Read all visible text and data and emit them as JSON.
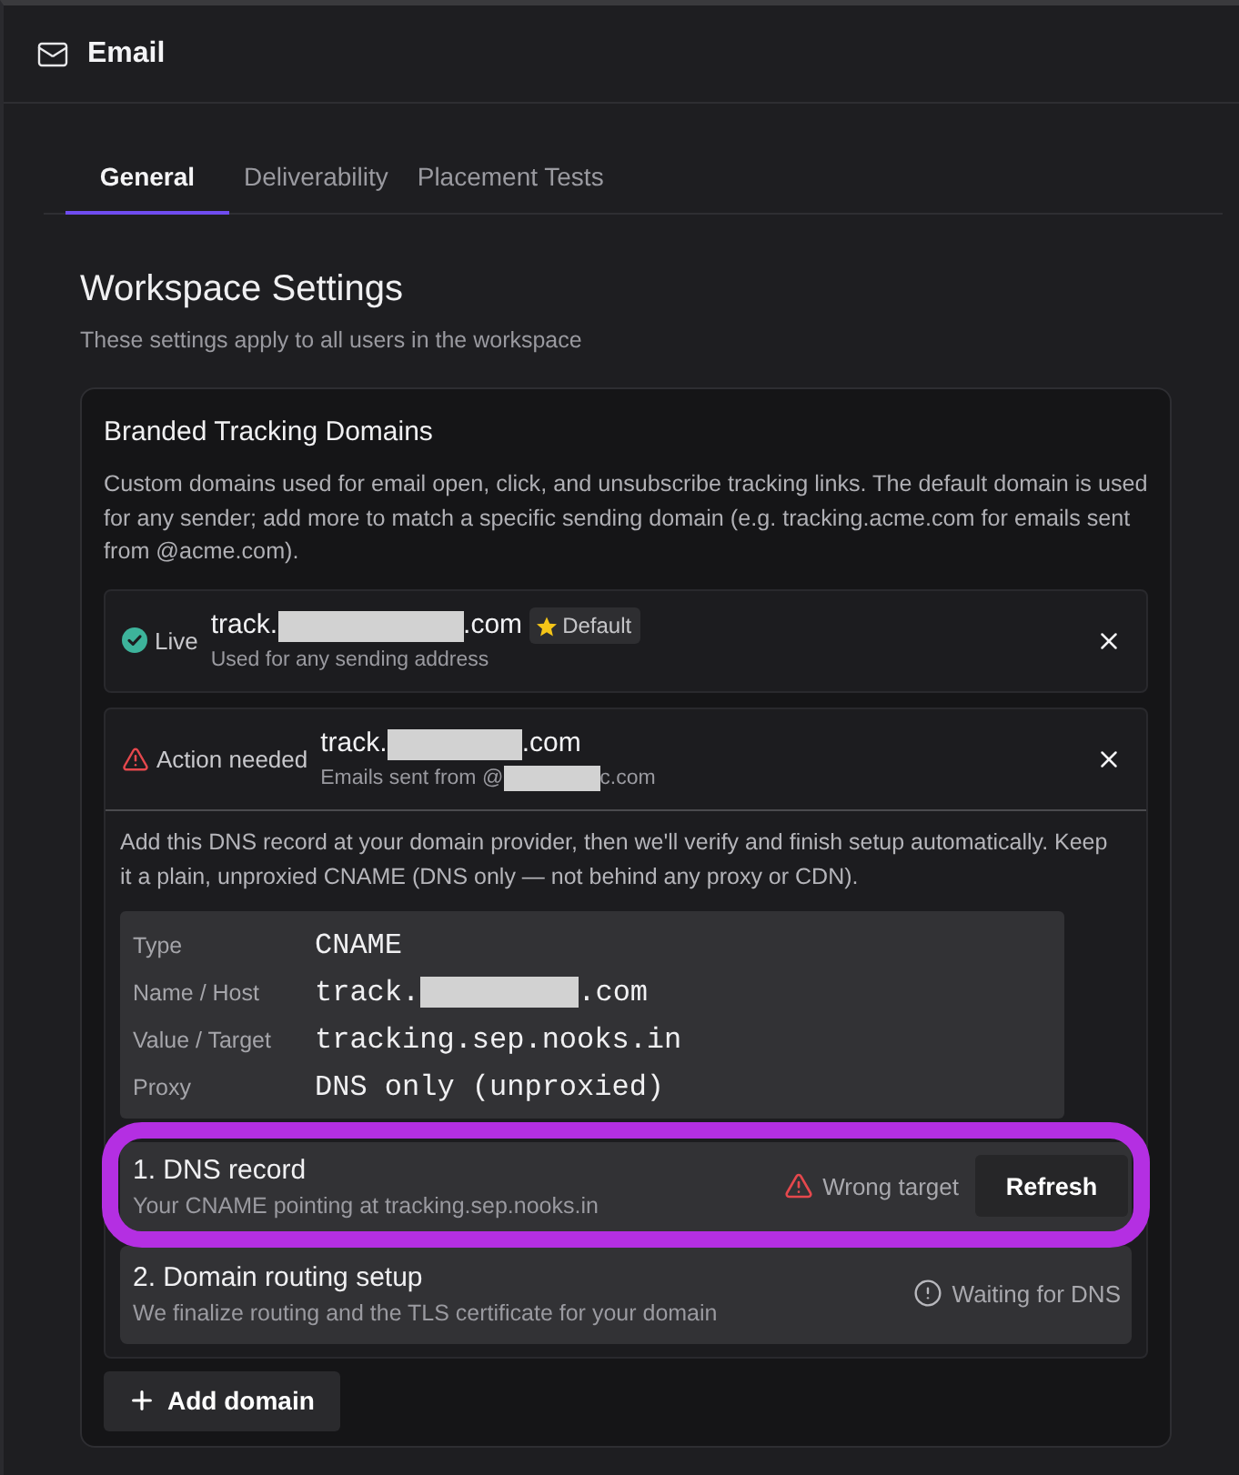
{
  "header": {
    "title": "Email"
  },
  "tabs": [
    {
      "label": "General",
      "selected": true
    },
    {
      "label": "Deliverability",
      "selected": false
    },
    {
      "label": "Placement Tests",
      "selected": false
    }
  ],
  "section": {
    "title": "Workspace Settings",
    "subtitle": "These settings apply to all users in the workspace"
  },
  "card": {
    "title": "Branded Tracking Domains",
    "description": "Custom domains used for email open, click, and unsubscribe tracking links. The default domain is used for any sender; add more to match a specific sending domain (e.g. tracking.acme.com for emails sent from @acme.com).",
    "domains": [
      {
        "kind": "live",
        "status_label": "Live",
        "domain": {
          "text": "track.",
          "redacted": true,
          "after": ".com"
        },
        "badge": "Default",
        "note": {
          "text": "Used for any sending address",
          "redacted": false
        },
        "expanded": false
      },
      {
        "kind": "action_needed",
        "status_label": "Action needed",
        "domain": {
          "text": "track.",
          "redacted": true,
          "after": ".com"
        },
        "note": {
          "text": "Emails sent from @",
          "redacted": true,
          "after": "c.com"
        },
        "expanded": true,
        "instructions": "Add this DNS record at your domain provider, then we'll verify and finish setup automatically. Keep it a plain, unproxied CNAME (DNS only — not behind any proxy or CDN).",
        "record": [
          {
            "label": "Type",
            "value": {
              "text": "CNAME",
              "redacted": false
            }
          },
          {
            "label": "Name / Host",
            "value": {
              "text": "track.",
              "redacted": true,
              "after": ".com"
            }
          },
          {
            "label": "Value / Target",
            "value": {
              "text": "tracking.sep.nooks.in",
              "redacted": false
            }
          },
          {
            "label": "Proxy",
            "value": {
              "text": "DNS only (unproxied)",
              "redacted": false
            }
          }
        ],
        "steps": [
          {
            "title": "1. DNS record",
            "subtitle": "Your CNAME pointing at tracking.sep.nooks.in",
            "kind": "error",
            "status_label": "Wrong target",
            "action": "Refresh",
            "highlighted": true
          },
          {
            "title": "2. Domain routing setup",
            "subtitle": "We finalize routing and the TLS certificate for your domain",
            "kind": "waiting",
            "status_label": "Waiting for DNS",
            "highlighted": false
          }
        ]
      }
    ],
    "add_button": "Add domain"
  }
}
